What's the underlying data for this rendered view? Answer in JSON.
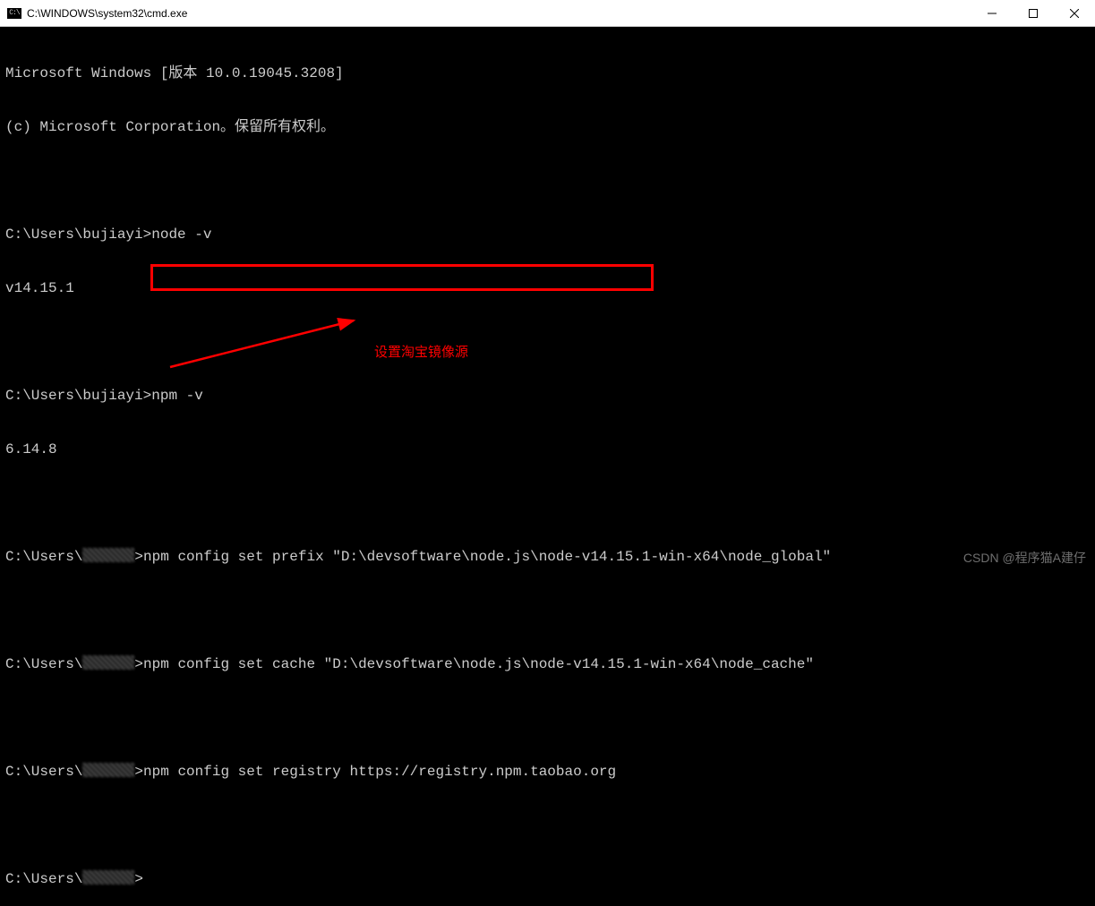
{
  "titlebar": {
    "icon_label": "C:\\",
    "title": "C:\\WINDOWS\\system32\\cmd.exe"
  },
  "terminal": {
    "header1": "Microsoft Windows [版本 10.0.19045.3208]",
    "header2": "(c) Microsoft Corporation。保留所有权利。",
    "prompt_user_full": "C:\\Users\\bujiayi>",
    "prompt_user_cens_prefix": "C:\\Users\\",
    "prompt_user_cens_suffix": ">",
    "cmd_node_v": "node -v",
    "out_node_v": "v14.15.1",
    "cmd_npm_v": "npm -v",
    "out_npm_v": "6.14.8",
    "cmd_prefix": "npm config set prefix \"D:\\devsoftware\\node.js\\node-v14.15.1-win-x64\\node_global\"",
    "cmd_cache": "npm config set cache \"D:\\devsoftware\\node.js\\node-v14.15.1-win-x64\\node_cache\"",
    "cmd_registry": "npm config set registry https://registry.npm.taobao.org"
  },
  "annotation": {
    "text": "设置淘宝镜像源"
  },
  "watermark": "CSDN @程序猫A建仔"
}
